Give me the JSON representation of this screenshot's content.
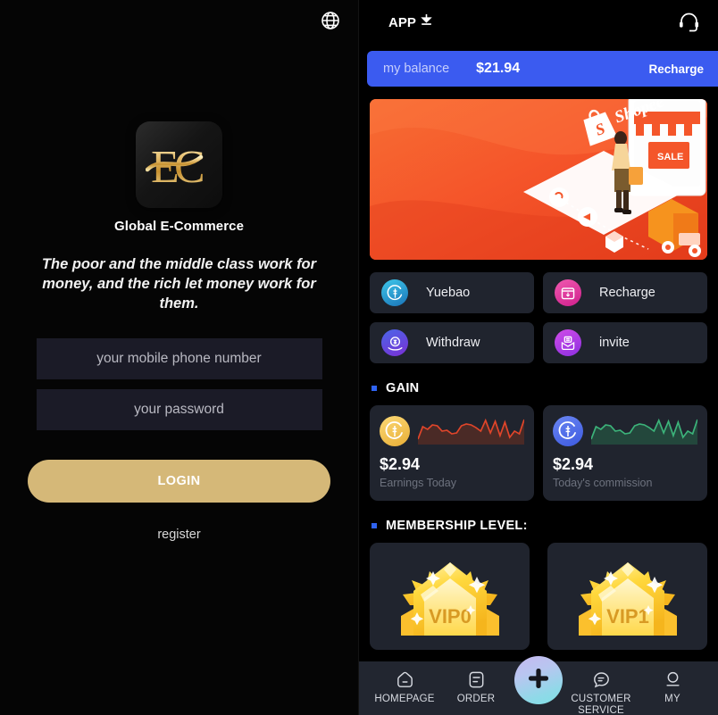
{
  "login": {
    "globe_icon": "globe-icon",
    "brand": "Global E-Commerce",
    "tagline": "The poor and the middle class work for money, and the rich let money work for them.",
    "phone_placeholder": "your mobile phone number",
    "phone_value": "",
    "password_placeholder": "your password",
    "password_value": "",
    "login_label": "LOGIN",
    "register_label": "register",
    "logo_text": "EC",
    "accent_gold": "#d5b878",
    "field_bg": "#1b1b27"
  },
  "app": {
    "topbar": {
      "app_label": "APP",
      "download_icon": "download-icon",
      "support_icon": "headset-support-icon"
    },
    "balance": {
      "label": "my balance",
      "amount": "$21.94",
      "recharge_label": "Recharge",
      "bar_color": "#3b5bf0"
    },
    "banner": {
      "name": "shopee-promo-banner",
      "brand_text": "Shopee",
      "sale_text": "SALE",
      "bg_color": "#f4562a"
    },
    "actions": [
      {
        "label": "Yuebao",
        "icon": "wallet-dollar-icon",
        "icon_class": "ico-yuebao"
      },
      {
        "label": "Recharge",
        "icon": "recharge-box-icon",
        "icon_class": "ico-recharge"
      },
      {
        "label": "Withdraw",
        "icon": "withdraw-hand-icon",
        "icon_class": "ico-withdraw"
      },
      {
        "label": "invite",
        "icon": "invite-envelope-icon",
        "icon_class": "ico-invite"
      }
    ],
    "gain": {
      "section_title": "GAIN",
      "cards": [
        {
          "amount": "$2.94",
          "caption": "Earnings Today",
          "coin_class": "coin-gold",
          "line_color": "#e0452a",
          "fill_color": "#4a2a26"
        },
        {
          "amount": "$2.94",
          "caption": "Today's commission",
          "coin_class": "coin-blue",
          "line_color": "#3cb37a",
          "fill_color": "#23473c"
        }
      ]
    },
    "membership": {
      "section_title": "MEMBERSHIP LEVEL:",
      "levels": [
        {
          "label": "VIP0"
        },
        {
          "label": "VIP1"
        }
      ]
    },
    "tabbar": [
      {
        "label": "HOMEPAGE",
        "icon": "home-icon"
      },
      {
        "label": "ORDER",
        "icon": "order-list-icon"
      },
      {
        "label": "",
        "icon": "plus-icon"
      },
      {
        "label": "CUSTOMER SERVICE",
        "icon": "chat-bubble-icon"
      },
      {
        "label": "MY",
        "icon": "user-person-icon"
      }
    ]
  },
  "chart_data": [
    {
      "type": "area",
      "title": "Earnings Today",
      "x": [
        0,
        1,
        2,
        3,
        4,
        5,
        6,
        7,
        8,
        9,
        10,
        11,
        12,
        13,
        14,
        15,
        16,
        17,
        18,
        19,
        20,
        21,
        22
      ],
      "values": [
        22,
        55,
        48,
        60,
        58,
        44,
        47,
        38,
        40,
        58,
        62,
        60,
        55,
        44,
        74,
        40,
        72,
        34,
        70,
        30,
        44,
        38,
        78
      ],
      "ylim": [
        0,
        100
      ],
      "grid": false,
      "legend": "none",
      "line_color": "#e0452a",
      "fill_color": "#4a2a26"
    },
    {
      "type": "area",
      "title": "Today's commission",
      "x": [
        0,
        1,
        2,
        3,
        4,
        5,
        6,
        7,
        8,
        9,
        10,
        11,
        12,
        13,
        14,
        15,
        16,
        17,
        18,
        19,
        20,
        21,
        22
      ],
      "values": [
        22,
        55,
        48,
        60,
        58,
        44,
        47,
        38,
        40,
        58,
        62,
        60,
        55,
        44,
        74,
        40,
        72,
        34,
        70,
        30,
        44,
        38,
        78
      ],
      "ylim": [
        0,
        100
      ],
      "grid": false,
      "legend": "none",
      "line_color": "#3cb37a",
      "fill_color": "#23473c"
    }
  ]
}
